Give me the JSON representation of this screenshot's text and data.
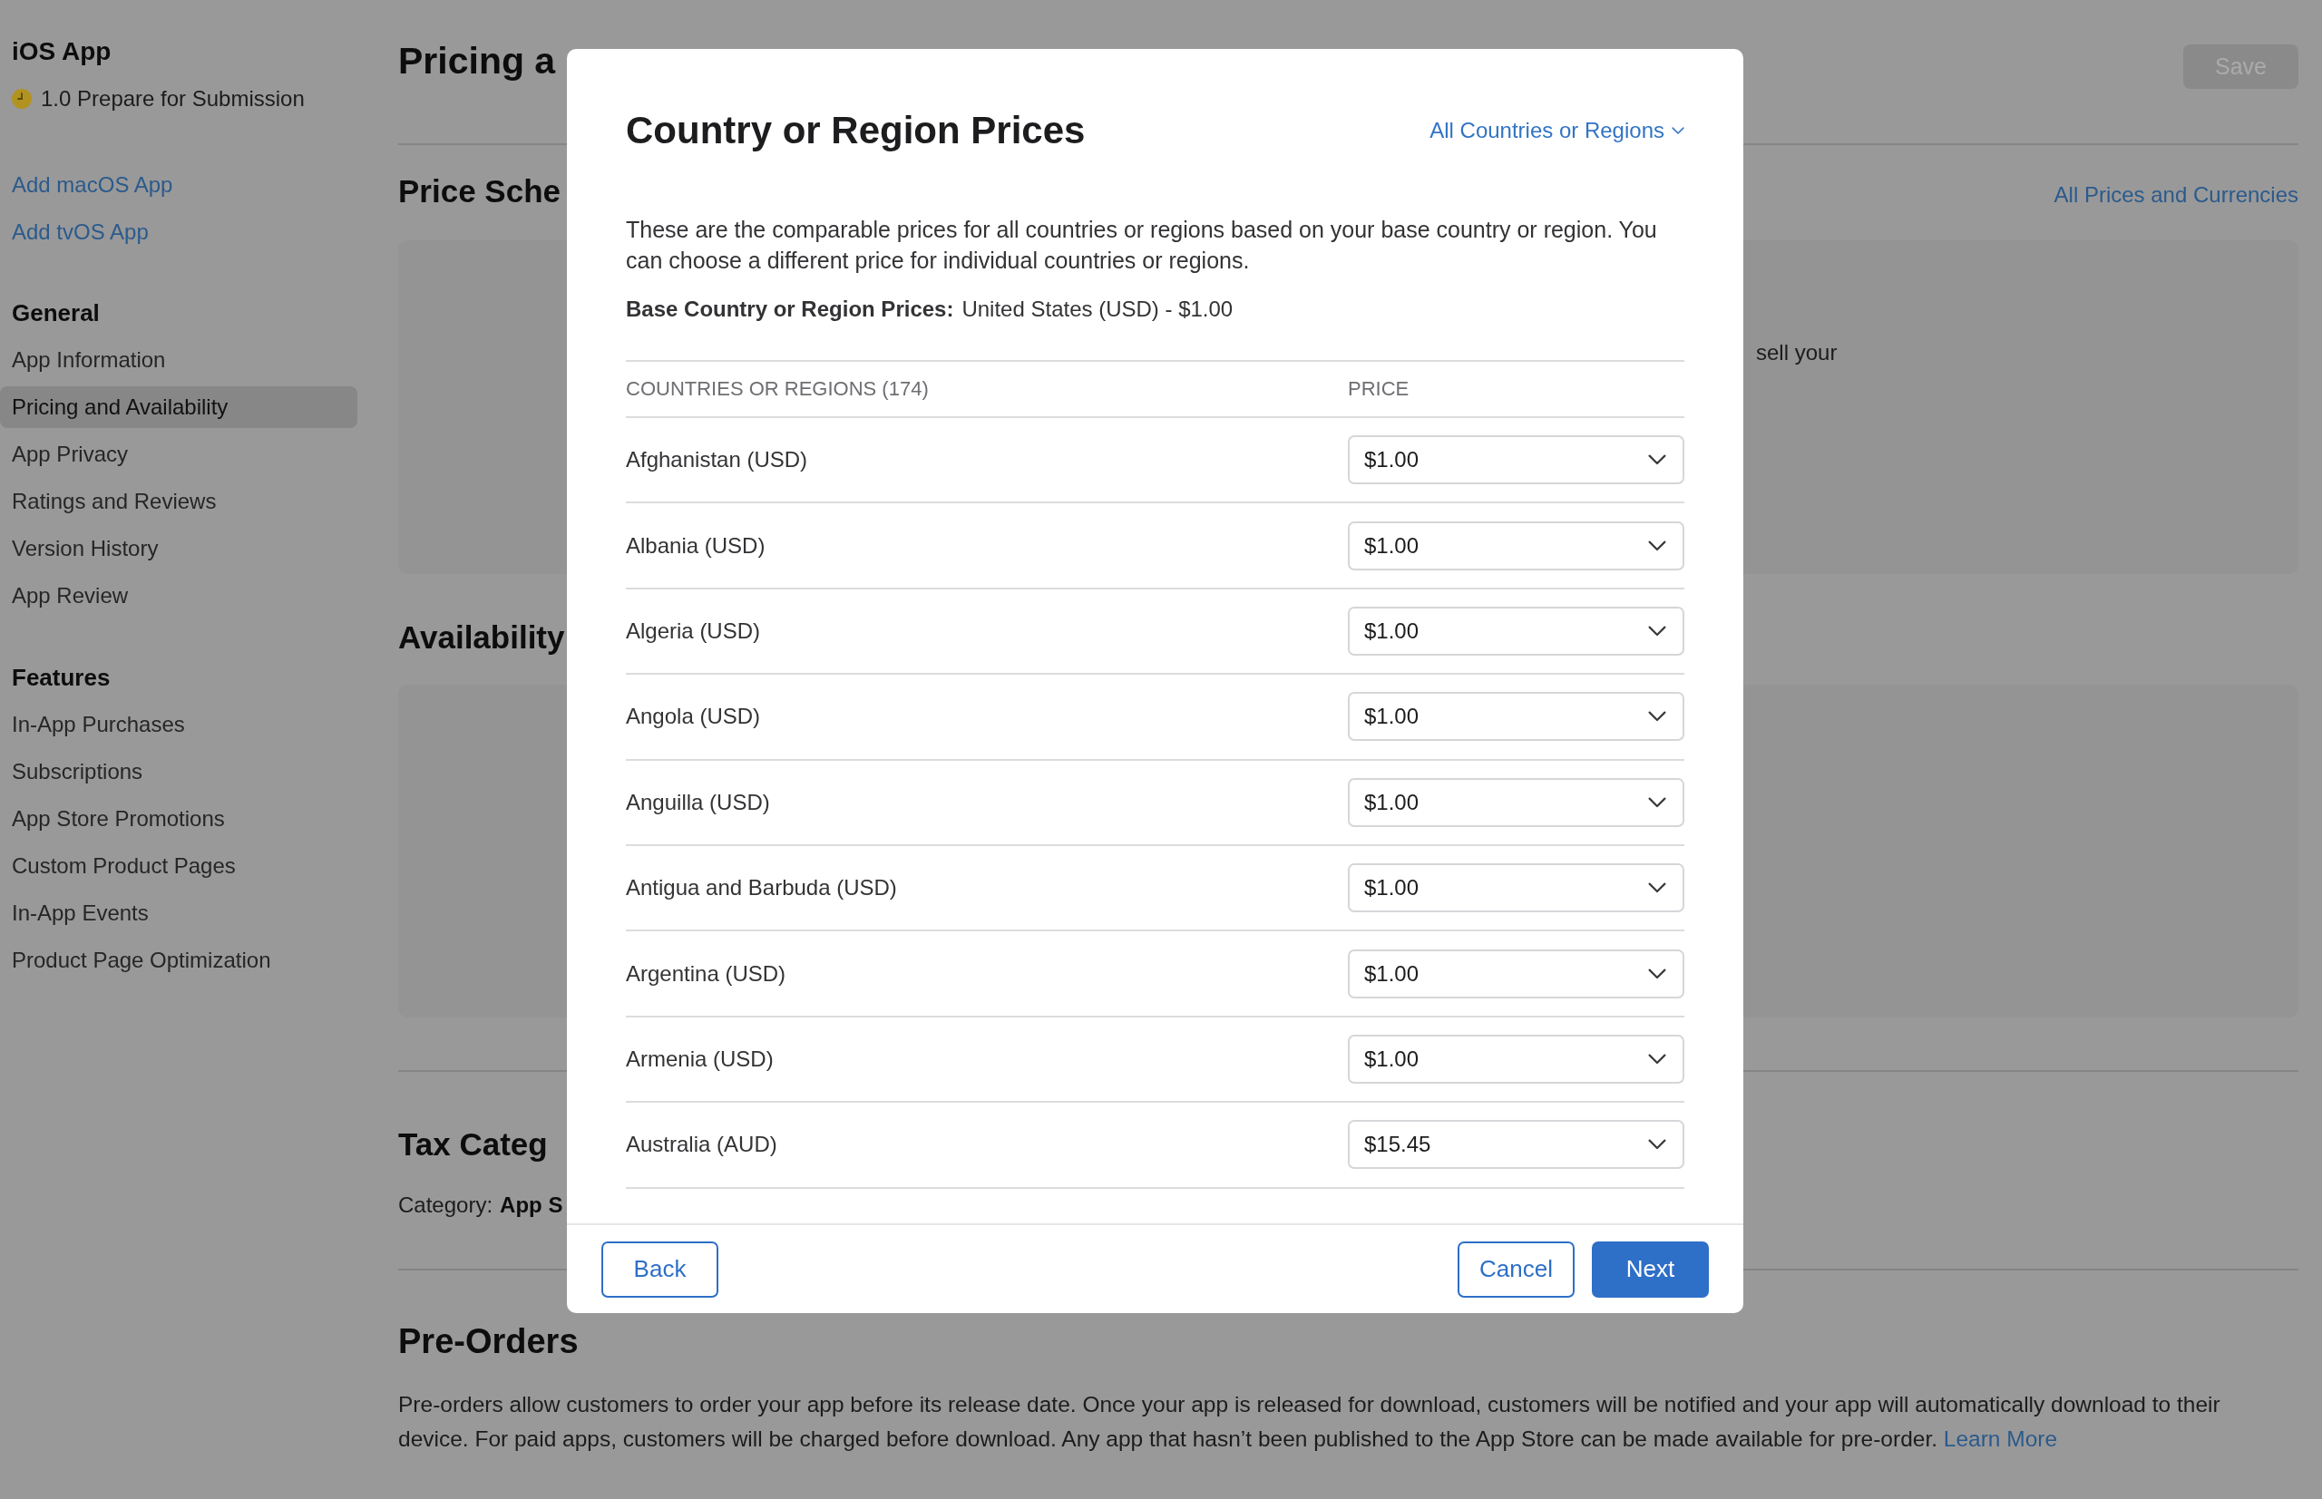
{
  "sidebar": {
    "app_title": "iOS App",
    "version": "1.0 Prepare for Submission",
    "links": [
      "Add macOS App",
      "Add tvOS App"
    ],
    "sections": [
      {
        "title": "General",
        "items": [
          {
            "label": "App Information",
            "selected": false
          },
          {
            "label": "Pricing and Availability",
            "selected": true
          },
          {
            "label": "App Privacy",
            "selected": false
          },
          {
            "label": "Ratings and Reviews",
            "selected": false
          },
          {
            "label": "Version History",
            "selected": false
          },
          {
            "label": "App Review",
            "selected": false
          }
        ]
      },
      {
        "title": "Features",
        "items": [
          {
            "label": "In-App Purchases",
            "selected": false
          },
          {
            "label": "Subscriptions",
            "selected": false
          },
          {
            "label": "App Store Promotions",
            "selected": false
          },
          {
            "label": "Custom Product Pages",
            "selected": false
          },
          {
            "label": "In-App Events",
            "selected": false
          },
          {
            "label": "Product Page Optimization",
            "selected": false
          }
        ]
      }
    ]
  },
  "page": {
    "title": "Pricing a",
    "save_button": {
      "label": "Save",
      "disabled": true
    },
    "price_schedule": {
      "title": "Price Sche",
      "link": "All Prices and Currencies",
      "panel_text": "sell your"
    },
    "availability": {
      "title": "Availability"
    },
    "tax_category": {
      "title": "Tax Categ",
      "label": "Category:",
      "value": "App S"
    },
    "pre_orders": {
      "title": "Pre-Orders",
      "text": "Pre-orders allow customers to order your app before its release date. Once your app is released for download, customers will be notified and your app will automatically download to their device. For paid apps, customers will be charged before download. Any app that hasn’t been published to the App Store can be made available for pre-order.",
      "link": "Learn More"
    }
  },
  "dialog": {
    "title": "Country or Region Prices",
    "filter": "All Countries or Regions",
    "description": "These are the comparable prices for all countries or regions based on your base country or region. You can choose a different price for individual countries or regions.",
    "base_price": {
      "label": "Base Country or Region Prices:",
      "value": "United States (USD) - $1.00"
    },
    "columns": [
      "COUNTRIES OR REGIONS (174)",
      "PRICE"
    ],
    "rows": [
      {
        "country": "Afghanistan (USD)",
        "price": "$1.00"
      },
      {
        "country": "Albania (USD)",
        "price": "$1.00"
      },
      {
        "country": "Algeria (USD)",
        "price": "$1.00"
      },
      {
        "country": "Angola (USD)",
        "price": "$1.00"
      },
      {
        "country": "Anguilla (USD)",
        "price": "$1.00"
      },
      {
        "country": "Antigua and Barbuda (USD)",
        "price": "$1.00"
      },
      {
        "country": "Argentina (USD)",
        "price": "$1.00"
      },
      {
        "country": "Armenia (USD)",
        "price": "$1.00"
      },
      {
        "country": "Australia (AUD)",
        "price": "$15.45"
      }
    ],
    "back_button": "Back",
    "actions": [
      {
        "label": "Cancel",
        "kind": "secondary"
      },
      {
        "label": "Next",
        "kind": "primary"
      }
    ]
  }
}
